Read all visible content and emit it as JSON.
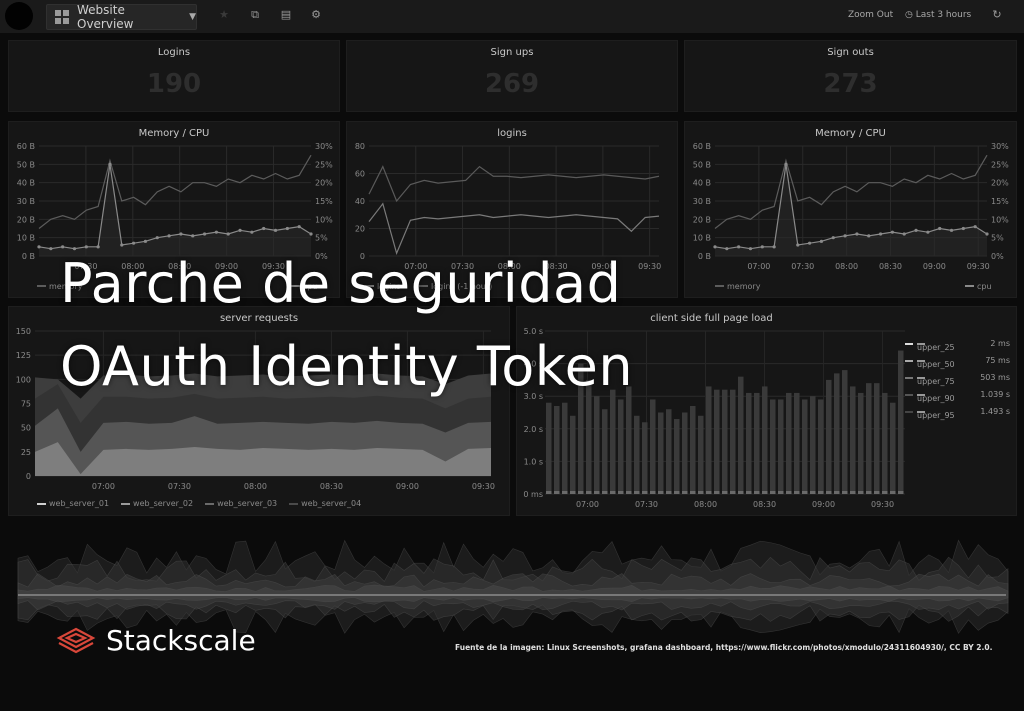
{
  "topbar": {
    "dashboard_title": "Website Overview",
    "icons": [
      "star-icon",
      "share-icon",
      "save-icon",
      "settings-icon"
    ],
    "zoom_out_label": "Zoom Out",
    "time_range_label": "Last 3 hours",
    "refresh_icon": "refresh-icon"
  },
  "stats": [
    {
      "title": "Logins",
      "value": "190"
    },
    {
      "title": "Sign ups",
      "value": "269"
    },
    {
      "title": "Sign outs",
      "value": "273"
    }
  ],
  "overlay": {
    "line1": "Parche de seguridad",
    "line2": "OAuth Identity Token"
  },
  "brand": {
    "name": "Stackscale",
    "accent": "#d9473a"
  },
  "credit": "Fuente de la imagen: Linux Screenshots, grafana dashboard, https://www.flickr.com/photos/xmodulo/24311604930/, CC BY 2.0.",
  "chart_data": [
    {
      "id": "memory-cpu-1",
      "type": "line",
      "title": "Memory / CPU",
      "categories": [
        "07:30",
        "08:00",
        "08:30",
        "09:00",
        "09:30"
      ],
      "y_ticks": [
        "0 B",
        "10 B",
        "20 B",
        "30 B",
        "40 B",
        "50 B",
        "60 B"
      ],
      "y2_ticks": [
        "0%",
        "5%",
        "10%",
        "15%",
        "20%",
        "25%",
        "30%"
      ],
      "ylim": [
        0,
        60
      ],
      "y2lim": [
        0,
        30
      ],
      "series": [
        {
          "name": "memory",
          "values": [
            15,
            20,
            22,
            20,
            25,
            27,
            52,
            30,
            32,
            28,
            35,
            38,
            35,
            40,
            40,
            38,
            42,
            40,
            44,
            42,
            45,
            42,
            44,
            55
          ]
        },
        {
          "name": "cpu",
          "values": [
            5,
            4,
            5,
            4,
            5,
            5,
            50,
            6,
            7,
            8,
            10,
            11,
            12,
            11,
            12,
            13,
            12,
            14,
            13,
            15,
            14,
            15,
            16,
            12
          ]
        }
      ],
      "legend": [
        "memory",
        "cpu"
      ]
    },
    {
      "id": "logins",
      "type": "line",
      "title": "logins",
      "categories": [
        "07:00",
        "07:30",
        "08:00",
        "08:30",
        "09:00",
        "09:30"
      ],
      "y_ticks": [
        "0",
        "20",
        "40",
        "60",
        "80"
      ],
      "ylim": [
        0,
        80
      ],
      "series": [
        {
          "name": "logins",
          "values": [
            25,
            38,
            2,
            26,
            28,
            27,
            28,
            29,
            30,
            28,
            29,
            30,
            29,
            28,
            29,
            30,
            29,
            28,
            27,
            18,
            28,
            29
          ]
        },
        {
          "name": "logins (-1 hour)",
          "values": [
            45,
            65,
            40,
            52,
            55,
            53,
            54,
            55,
            65,
            58,
            58,
            57,
            58,
            59,
            58,
            57,
            58,
            59,
            58,
            57,
            56,
            58
          ]
        }
      ],
      "legend": [
        "logins",
        "logins (-1 hour)"
      ]
    },
    {
      "id": "memory-cpu-2",
      "type": "line",
      "title": "Memory / CPU",
      "categories": [
        "07:00",
        "07:30",
        "08:00",
        "08:30",
        "09:00",
        "09:30"
      ],
      "y_ticks": [
        "0 B",
        "10 B",
        "20 B",
        "30 B",
        "40 B",
        "50 B",
        "60 B"
      ],
      "y2_ticks": [
        "0%",
        "5%",
        "10%",
        "15%",
        "20%",
        "25%",
        "30%"
      ],
      "ylim": [
        0,
        60
      ],
      "y2lim": [
        0,
        30
      ],
      "series": [
        {
          "name": "memory",
          "values": [
            15,
            20,
            22,
            20,
            25,
            27,
            52,
            30,
            32,
            28,
            35,
            38,
            35,
            40,
            40,
            38,
            42,
            40,
            44,
            42,
            45,
            42,
            44,
            55
          ]
        },
        {
          "name": "cpu",
          "values": [
            5,
            4,
            5,
            4,
            5,
            5,
            50,
            6,
            7,
            8,
            10,
            11,
            12,
            11,
            12,
            13,
            12,
            14,
            13,
            15,
            14,
            15,
            16,
            12
          ]
        }
      ],
      "legend": [
        "memory",
        "cpu"
      ]
    },
    {
      "id": "server-requests",
      "type": "area",
      "title": "server requests",
      "categories": [
        "07:00",
        "07:30",
        "08:00",
        "08:30",
        "09:00",
        "09:30"
      ],
      "y_ticks": [
        "0",
        "25",
        "50",
        "75",
        "100",
        "125",
        "150"
      ],
      "ylim": [
        0,
        150
      ],
      "series": [
        {
          "name": "web_server_01",
          "values": [
            25,
            35,
            2,
            27,
            28,
            27,
            28,
            30,
            28,
            27,
            29,
            28,
            27,
            28,
            27,
            29,
            28,
            27,
            15,
            28,
            29
          ]
        },
        {
          "name": "web_server_02",
          "values": [
            52,
            70,
            25,
            55,
            56,
            54,
            55,
            62,
            54,
            55,
            56,
            55,
            54,
            56,
            55,
            57,
            55,
            54,
            45,
            55,
            56
          ]
        },
        {
          "name": "web_server_03",
          "values": [
            80,
            95,
            55,
            82,
            82,
            80,
            81,
            85,
            80,
            81,
            82,
            80,
            81,
            82,
            81,
            83,
            81,
            80,
            70,
            80,
            82
          ]
        },
        {
          "name": "web_server_04",
          "values": [
            102,
            100,
            80,
            104,
            105,
            103,
            104,
            106,
            103,
            104,
            105,
            103,
            104,
            105,
            104,
            106,
            104,
            103,
            95,
            104,
            106
          ]
        }
      ],
      "legend": [
        "web_server_01",
        "web_server_02",
        "web_server_03",
        "web_server_04"
      ]
    },
    {
      "id": "client-page-load",
      "type": "bar",
      "title": "client side full page load",
      "categories": [
        "07:00",
        "07:30",
        "08:00",
        "08:30",
        "09:00",
        "09:30"
      ],
      "y_ticks": [
        "0 ms",
        "1.0 s",
        "2.0 s",
        "3.0 s",
        "4.0 s",
        "5.0 s"
      ],
      "ylim": [
        0,
        5
      ],
      "values": [
        2.8,
        2.7,
        2.8,
        2.4,
        4.0,
        3.5,
        3.0,
        2.6,
        3.2,
        2.9,
        3.3,
        2.4,
        2.2,
        2.9,
        2.5,
        2.6,
        2.3,
        2.5,
        2.7,
        2.4,
        3.3,
        3.2,
        3.2,
        3.2,
        3.6,
        3.1,
        3.1,
        3.3,
        2.9,
        2.9,
        3.1,
        3.1,
        2.9,
        3.0,
        2.9,
        3.5,
        3.7,
        3.8,
        3.3,
        3.1,
        3.4,
        3.4,
        3.1,
        2.8,
        4.4
      ],
      "legend": [
        {
          "name": "upper_25",
          "current": "2 ms"
        },
        {
          "name": "upper_50",
          "current": "75 ms"
        },
        {
          "name": "upper_75",
          "current": "503 ms"
        },
        {
          "name": "upper_90",
          "current": "1.039 s"
        },
        {
          "name": "upper_95",
          "current": "1.493 s"
        }
      ]
    }
  ]
}
